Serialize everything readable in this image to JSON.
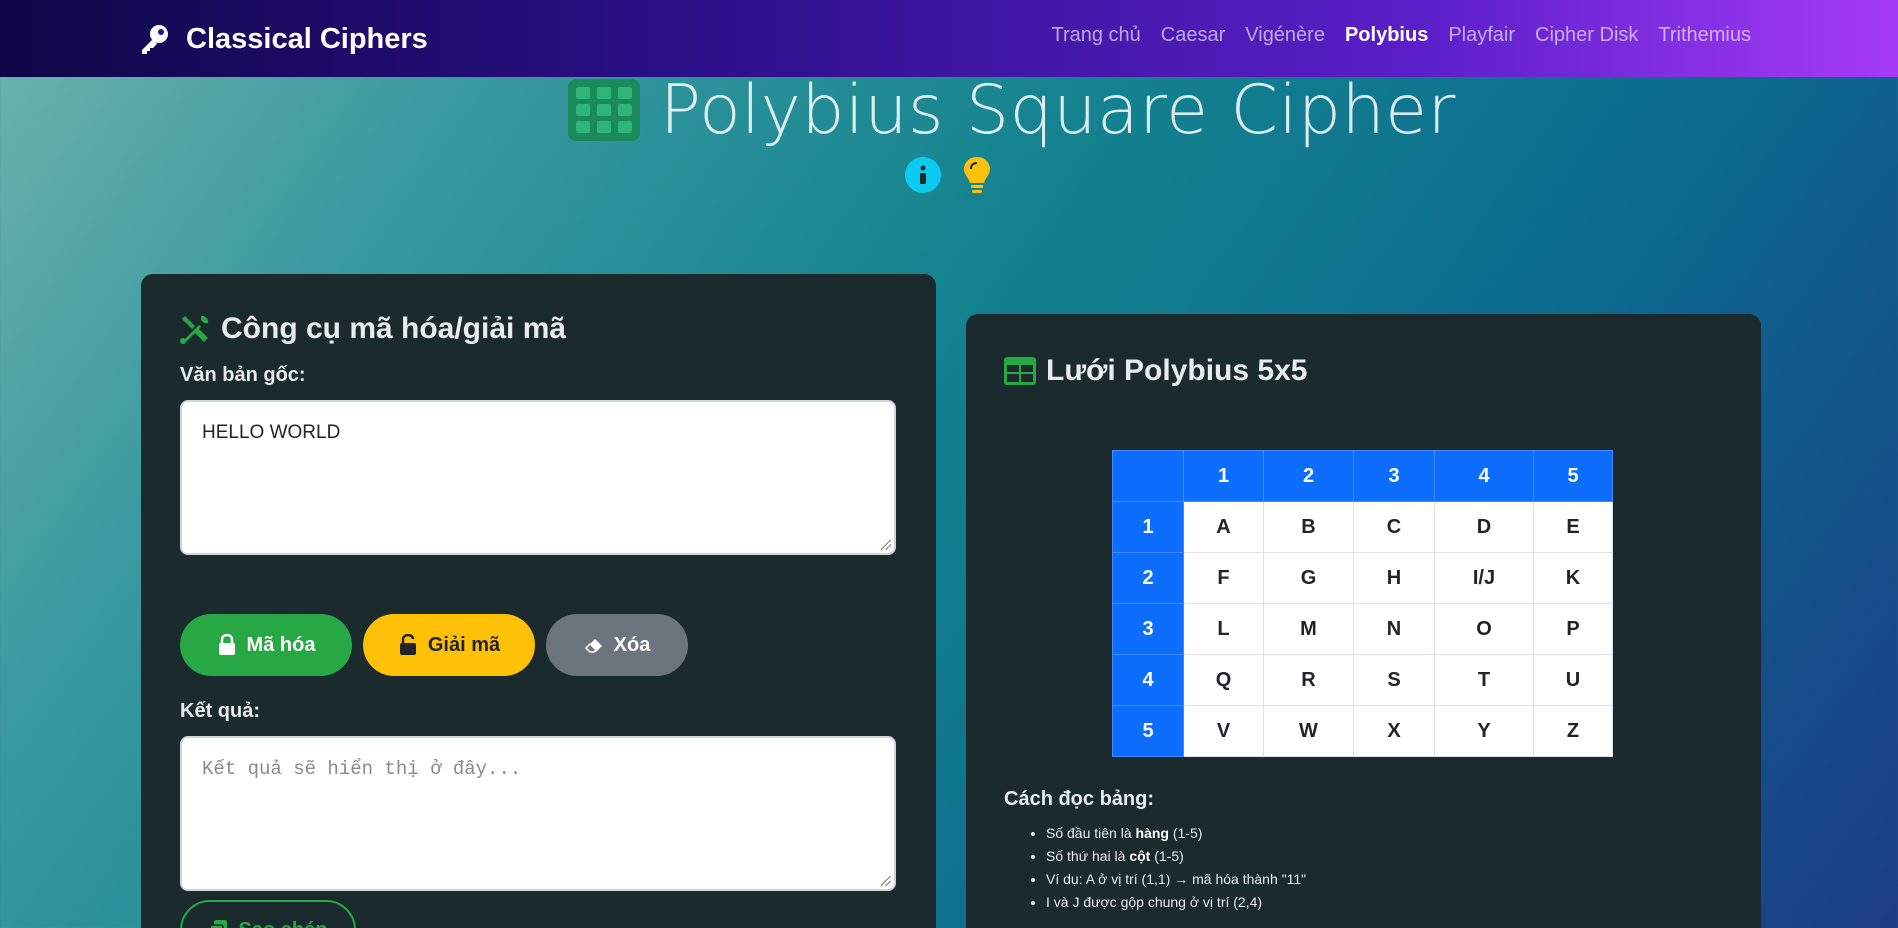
{
  "nav": {
    "brand": "Classical Ciphers",
    "links": [
      {
        "label": "Trang chủ",
        "active": false
      },
      {
        "label": "Caesar",
        "active": false
      },
      {
        "label": "Vigénère",
        "active": false
      },
      {
        "label": "Polybius",
        "active": true
      },
      {
        "label": "Playfair",
        "active": false
      },
      {
        "label": "Cipher Disk",
        "active": false
      },
      {
        "label": "Trithemius",
        "active": false
      }
    ]
  },
  "header": {
    "title": "Polybius Square Cipher",
    "icons": [
      "table-icon",
      "info-icon",
      "lightbulb-icon"
    ]
  },
  "tool": {
    "title": "Công cụ mã hóa/giải mã",
    "input_label": "Văn bản gốc:",
    "input_value": "HELLO WORLD",
    "buttons": {
      "encrypt": "Mã hóa",
      "decrypt": "Giải mã",
      "clear": "Xóa",
      "copy": "Sao chép"
    },
    "result_label": "Kết quả:",
    "result_placeholder": "Kết quả sẽ hiển thị ở đây..."
  },
  "grid": {
    "title": "Lưới Polybius 5x5",
    "col_headers": [
      "1",
      "2",
      "3",
      "4",
      "5"
    ],
    "rows": [
      {
        "head": "1",
        "cells": [
          "A",
          "B",
          "C",
          "D",
          "E"
        ]
      },
      {
        "head": "2",
        "cells": [
          "F",
          "G",
          "H",
          "I/J",
          "K"
        ]
      },
      {
        "head": "3",
        "cells": [
          "L",
          "M",
          "N",
          "O",
          "P"
        ]
      },
      {
        "head": "4",
        "cells": [
          "Q",
          "R",
          "S",
          "T",
          "U"
        ]
      },
      {
        "head": "5",
        "cells": [
          "V",
          "W",
          "X",
          "Y",
          "Z"
        ]
      }
    ],
    "howto_title": "Cách đọc bảng:",
    "howto": {
      "item1_pre": "Số đầu tiên là ",
      "item1_bold": "hàng",
      "item1_post": " (1-5)",
      "item2_pre": "Số thứ hai là ",
      "item2_bold": "cột",
      "item2_post": " (1-5)",
      "item3": "Ví dụ: A ở vị trí (1,1) → mã hóa thành \"11\"",
      "item4": "I và J được gộp chung ở vị trí (2,4)"
    }
  },
  "colors": {
    "encrypt": "#28a745",
    "decrypt": "#ffc107",
    "clear": "#6c757d",
    "grid_header": "#0d6efd",
    "card_bg": "#1b2a2c"
  }
}
